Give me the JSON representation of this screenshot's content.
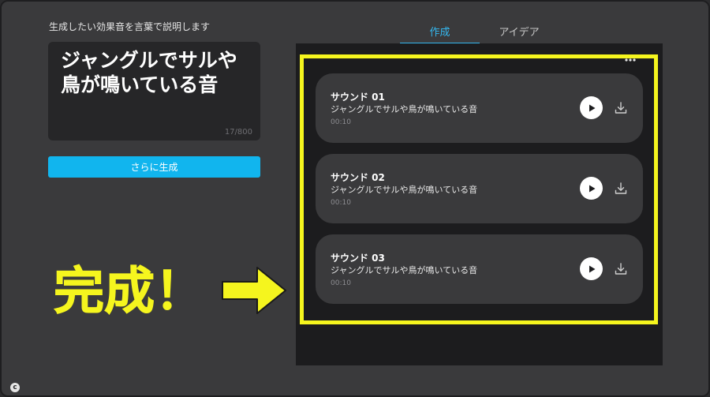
{
  "prompt": {
    "label": "生成したい効果音を言葉で説明します",
    "text": "ジャングルでサルや鳥が鳴いている音",
    "char_count": "17/800",
    "generate_button": "さらに生成"
  },
  "tabs": [
    {
      "label": "作成",
      "active": true
    },
    {
      "label": "アイデア",
      "active": false
    }
  ],
  "results": [
    {
      "title": "サウンド 01",
      "description": "ジャングルでサルや鳥が鳴いている音",
      "duration": "00:10"
    },
    {
      "title": "サウンド 02",
      "description": "ジャングルでサルや鳥が鳴いている音",
      "duration": "00:10"
    },
    {
      "title": "サウンド 03",
      "description": "ジャングルでサルや鳥が鳴いている音",
      "duration": "00:10"
    }
  ],
  "annotation": {
    "text": "完成！",
    "color": "#f5f51e"
  },
  "colors": {
    "accent": "#11b5ee",
    "background": "#3a3a3c",
    "panel": "#1c1c1e"
  },
  "icons": {
    "more": "more-horizontal-icon",
    "play": "play-icon",
    "download": "download-icon",
    "arrow": "arrow-right-icon"
  }
}
